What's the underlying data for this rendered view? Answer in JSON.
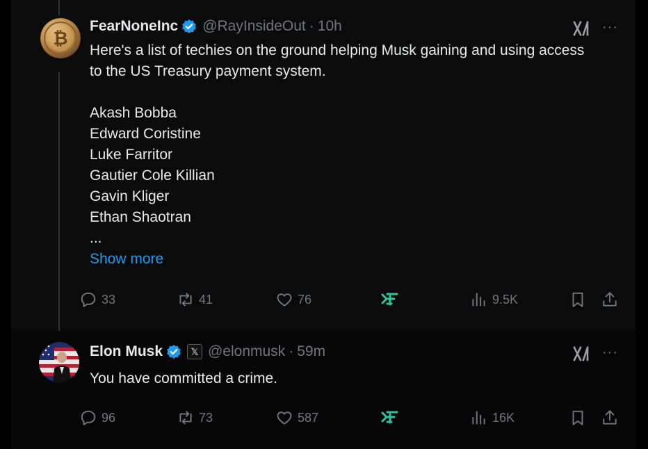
{
  "tweets": [
    {
      "name": "FearNoneInc",
      "handle": "@RayInsideOut",
      "dot": "·",
      "time": "10h",
      "lines": [
        "Here's a list of techies on the ground helping Musk gaining and using access",
        "to the US Treasury payment system.",
        "",
        "Akash Bobba",
        "Edward Coristine",
        "Luke Farritor",
        "Gautier Cole Killian",
        "Gavin Kliger",
        "Ethan Shaotran",
        "..."
      ],
      "show_more": "Show more",
      "replies": "33",
      "reposts": "41",
      "likes": "76",
      "views": "9.5K"
    },
    {
      "name": "Elon Musk",
      "x_badge": "𝕏",
      "handle": "@elonmusk",
      "dot": "·",
      "time": "59m",
      "text": "You have committed a crime.",
      "replies": "96",
      "reposts": "73",
      "likes": "587",
      "views": "16K"
    }
  ],
  "more_label": "···",
  "colors": {
    "background": "#0b0b0b",
    "text": "#e7e9ea",
    "muted": "#71767b",
    "link": "#1d9bf0",
    "verified": "#1d9bf0",
    "accent_green": "#2ec4a0"
  },
  "icons": [
    "verified-badge-icon",
    "grok-icon",
    "more-icon",
    "reply-icon",
    "repost-icon",
    "like-icon",
    "extension-icon",
    "views-icon",
    "bookmark-icon",
    "share-icon"
  ]
}
